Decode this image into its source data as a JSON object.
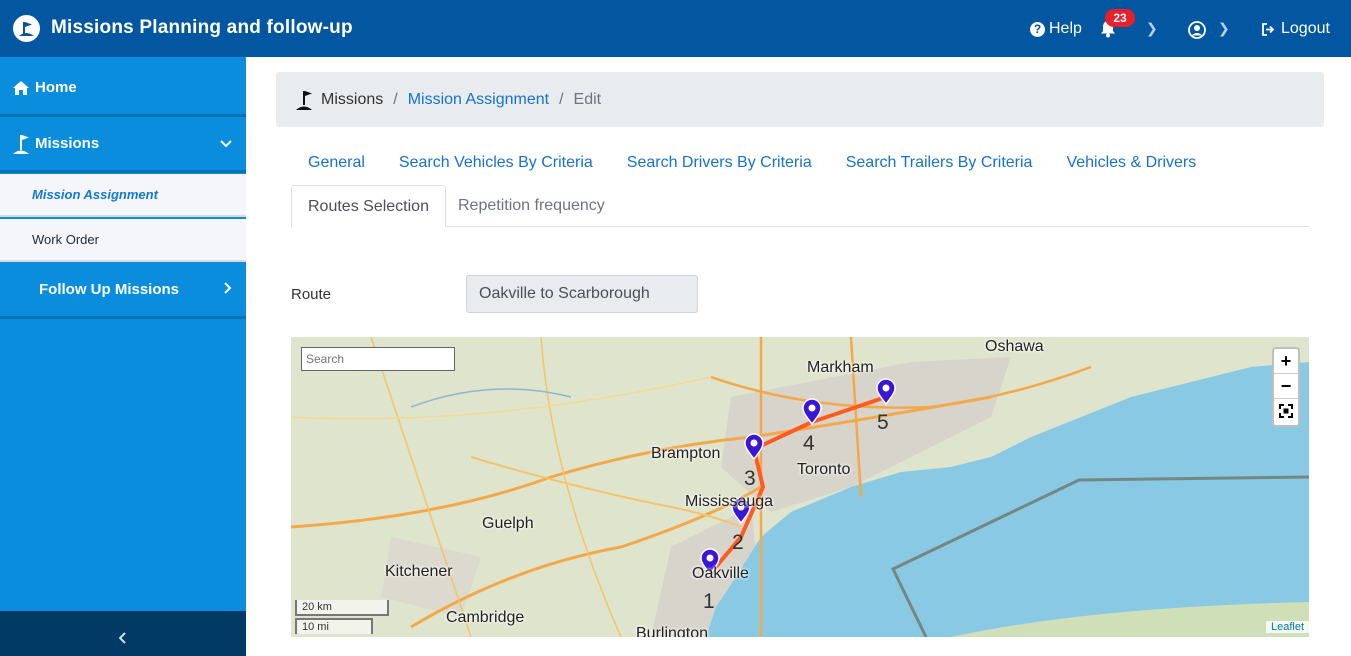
{
  "header": {
    "title": "Missions Planning and follow-up",
    "help_label": "Help",
    "notifications_count": "23",
    "logout_label": "Logout"
  },
  "sidebar": {
    "items": [
      {
        "label": "Home"
      },
      {
        "label": "Missions"
      },
      {
        "label": "Mission Assignment"
      },
      {
        "label": "Work Order"
      },
      {
        "label": "Follow Up Missions"
      }
    ]
  },
  "breadcrumb": {
    "root": "Missions",
    "link": "Mission Assignment",
    "current": "Edit"
  },
  "tabs": {
    "row1": [
      "General",
      "Search Vehicles By Criteria",
      "Search Drivers By Criteria",
      "Search Trailers By Criteria",
      "Vehicles & Drivers"
    ],
    "active": "Routes Selection",
    "inactive": "Repetition frequency"
  },
  "route": {
    "label": "Route",
    "value": "Oakville to Scarborough"
  },
  "map": {
    "search_placeholder": "Search",
    "zoom_in": "+",
    "zoom_out": "−",
    "scale_km": "20 km",
    "scale_mi": "10 mi",
    "attribution": "Leaflet",
    "cities": [
      "Oshawa",
      "Markham",
      "Brampton",
      "Toronto",
      "Mississauga",
      "Guelph",
      "Kitchener",
      "Oakville",
      "Cambridge",
      "Burlington"
    ],
    "waypoints": [
      "1",
      "2",
      "3",
      "4",
      "5"
    ],
    "colors": {
      "route": "#ff5a1f",
      "marker": "#3a16d6",
      "water": "#89c9e3"
    }
  }
}
